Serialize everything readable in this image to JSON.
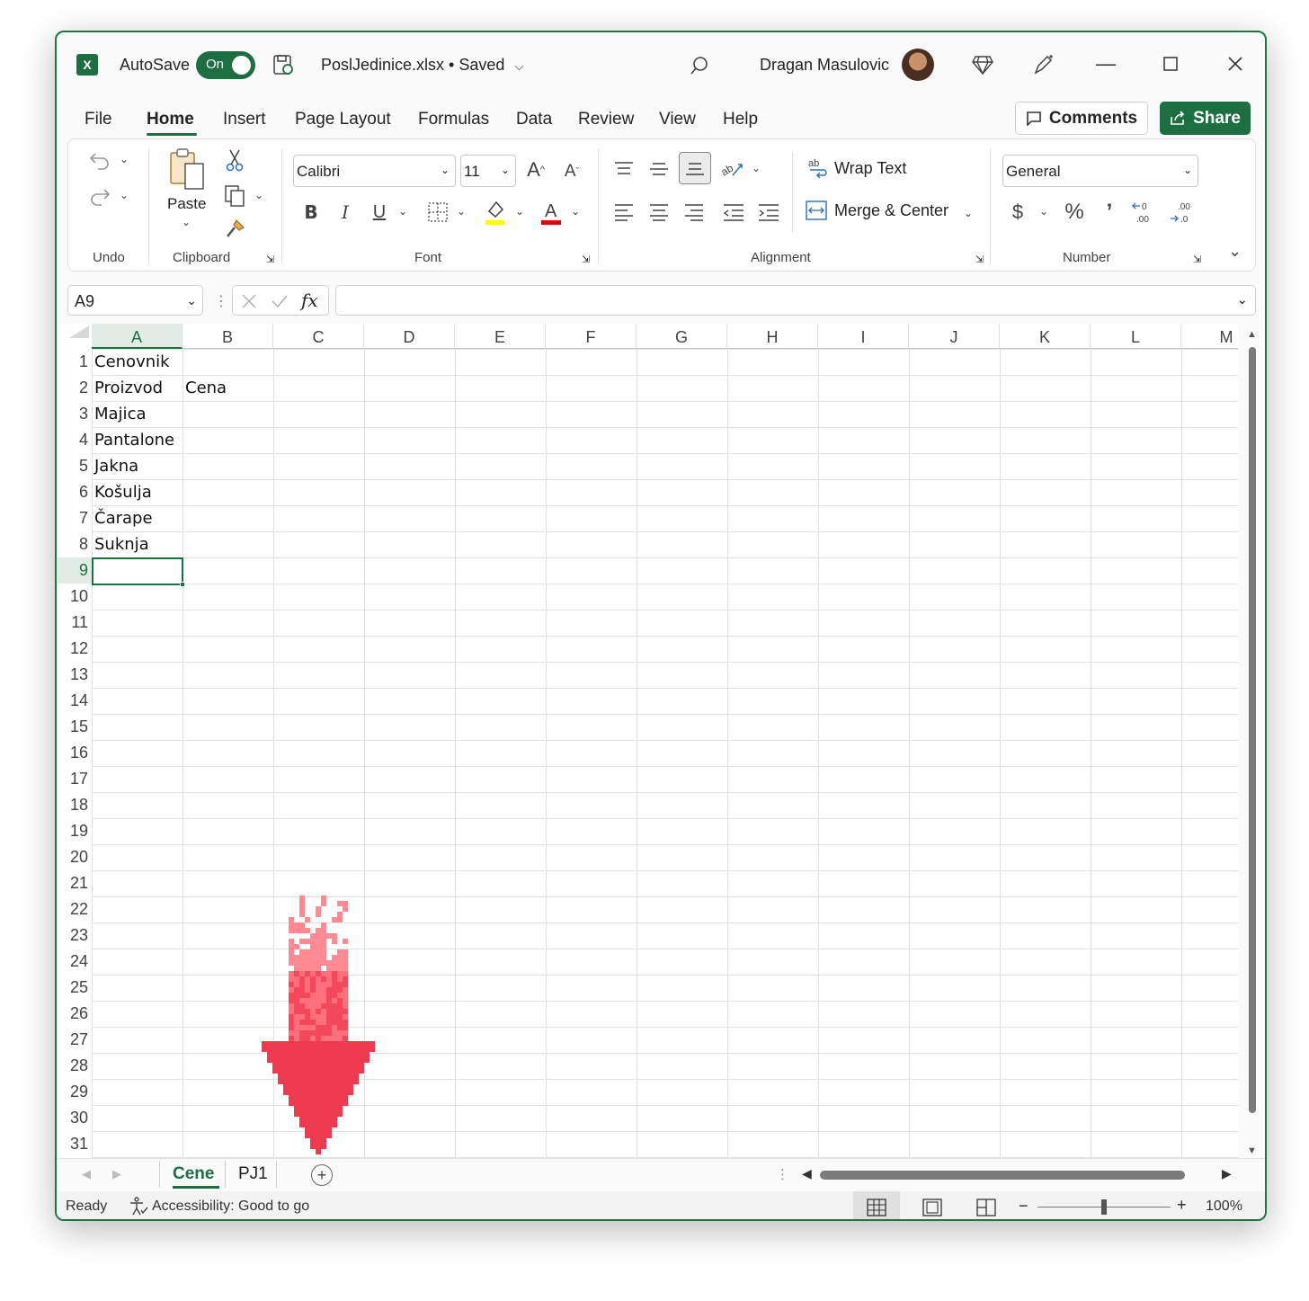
{
  "titlebar": {
    "app_logo": "excel-icon",
    "autosave_label": "AutoSave",
    "autosave_state": "On",
    "file_title": "PoslJedinice.xlsx • Saved",
    "user_name": "Dragan Masulovic"
  },
  "tabs": [
    "File",
    "Home",
    "Insert",
    "Page Layout",
    "Formulas",
    "Data",
    "Review",
    "View",
    "Help"
  ],
  "active_tab": "Home",
  "actions": {
    "comments": "Comments",
    "share": "Share"
  },
  "ribbon": {
    "groups": {
      "undo": "Undo",
      "clipboard": "Clipboard",
      "font": "Font",
      "alignment": "Alignment",
      "number": "Number"
    },
    "paste_label": "Paste",
    "font_name": "Calibri",
    "font_size": "11",
    "wrap_text": "Wrap Text",
    "merge_center": "Merge & Center",
    "number_format": "General",
    "accent_colors": {
      "highlight": "#ffff00",
      "font_color": "#e00000",
      "brand": "#1d6f42"
    }
  },
  "formula_bar": {
    "name_box": "A9",
    "fx_label": "fx",
    "formula": ""
  },
  "columns": [
    "A",
    "B",
    "C",
    "D",
    "E",
    "F",
    "G",
    "H",
    "I",
    "J",
    "K",
    "L",
    "M"
  ],
  "rows": [
    "1",
    "2",
    "3",
    "4",
    "5",
    "6",
    "7",
    "8",
    "9",
    "10",
    "11",
    "12",
    "13",
    "14",
    "15",
    "16",
    "17",
    "18",
    "19",
    "20",
    "21",
    "22",
    "23",
    "24",
    "25",
    "26",
    "27",
    "28",
    "29",
    "30",
    "31"
  ],
  "cells": {
    "A1": "Cenovnik",
    "A2": "Proizvod",
    "B2": "Cena",
    "A3": "Majica",
    "A4": "Pantalone",
    "A5": "Jakna",
    "A6": "Košulja",
    "A7": "Čarape",
    "A8": "Suknja"
  },
  "selected_cell": "A9",
  "sheets": [
    "Cene",
    "PJ1"
  ],
  "active_sheet": "Cene",
  "status": {
    "ready": "Ready",
    "accessibility": "Accessibility: Good to go",
    "zoom": "100%",
    "zoom_level_percent": 100
  }
}
